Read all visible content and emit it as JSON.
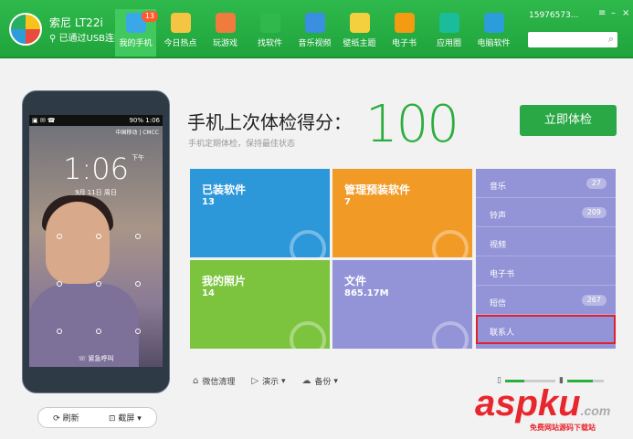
{
  "header": {
    "device_name": "索尼 LT22i",
    "device_status": "已通过USB连接",
    "account": "15976573...",
    "search_placeholder": "",
    "nav": [
      {
        "label": "我的手机",
        "icon": "phone-icon",
        "badge": "13",
        "active": true,
        "color": "#3aa7e8"
      },
      {
        "label": "今日热点",
        "icon": "star-icon",
        "color": "#f6c443"
      },
      {
        "label": "玩游戏",
        "icon": "gamepad-icon",
        "color": "#f07b3f"
      },
      {
        "label": "找软件",
        "icon": "android-icon",
        "color": "#2fb94c"
      },
      {
        "label": "音乐视频",
        "icon": "play-icon",
        "color": "#3a8fe0"
      },
      {
        "label": "壁纸主题",
        "icon": "wallpaper-icon",
        "color": "#f4d03f"
      },
      {
        "label": "电子书",
        "icon": "book-icon",
        "color": "#f39c12"
      },
      {
        "label": "应用圈",
        "icon": "circle-icon",
        "color": "#1abc9c"
      },
      {
        "label": "电脑软件",
        "icon": "grid-icon",
        "color": "#2d9cdb"
      }
    ]
  },
  "phone": {
    "battery": "90%",
    "status_time": "1:06",
    "carrier": "中国移动 | CMCC",
    "clock": "1:06",
    "ampm": "下午",
    "date": "9月 11日 周日",
    "emergency": "紧急呼叫",
    "refresh_label": "刷新",
    "screenshot_label": "截屏"
  },
  "score": {
    "title": "手机上次体检得分：",
    "subtitle": "手机定期体检，保持最佳状态",
    "value": "100",
    "button_label": "立即体检"
  },
  "tiles": [
    {
      "title": "已装软件",
      "value": "13"
    },
    {
      "title": "管理预装软件",
      "value": "7"
    },
    {
      "title": "我的照片",
      "value": "14"
    },
    {
      "title": "文件",
      "value": "865.17M"
    }
  ],
  "side_list": [
    {
      "label": "音乐",
      "count": "27"
    },
    {
      "label": "铃声",
      "count": "209"
    },
    {
      "label": "视频",
      "count": ""
    },
    {
      "label": "电子书",
      "count": ""
    },
    {
      "label": "短信",
      "count": "267"
    },
    {
      "label": "联系人",
      "count": "",
      "highlight": true
    }
  ],
  "toolbar": {
    "clean_label": "微信清理",
    "demo_label": "演示",
    "backup_label": "备份"
  },
  "watermark": {
    "brand": "aspku",
    "suffix": ".com",
    "sub": "免费网站源码下载站"
  },
  "colors": {
    "header_green": "#1fa43c",
    "score_green": "#2cae3f",
    "tile_blue": "#2c97d9",
    "tile_orange": "#f29a26",
    "tile_green": "#7cc43e",
    "tile_purple": "#9393d8",
    "highlight_red": "#e0202e"
  }
}
